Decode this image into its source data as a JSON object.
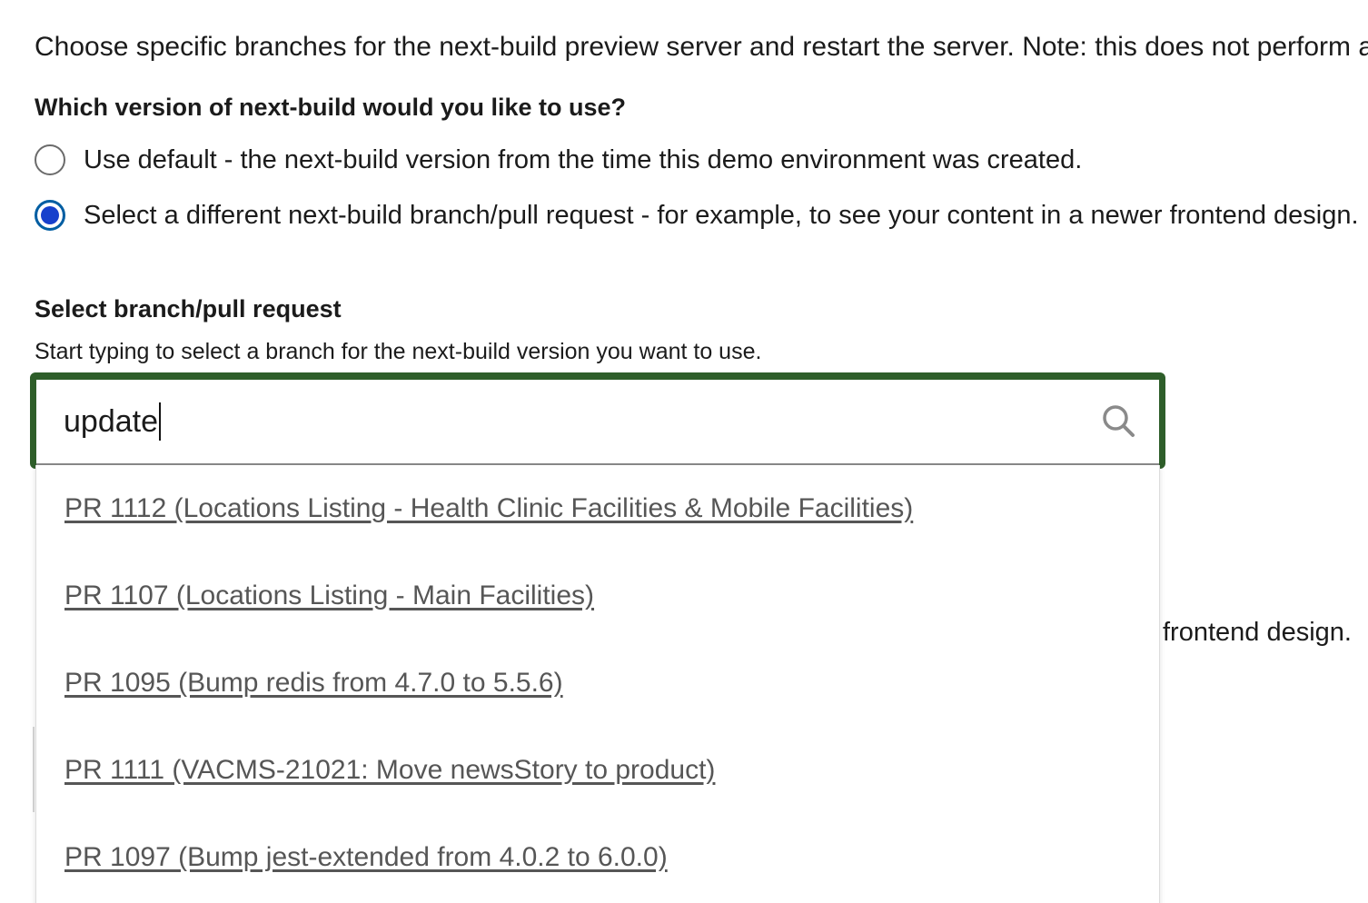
{
  "intro_text": "Choose specific branches for the next-build preview server and restart the server. Note: this does not perform a",
  "version_question": "Which version of next-build would you like to use?",
  "radio_options": [
    {
      "label": "Use default - the next-build version from the time this demo environment was created.",
      "checked": false
    },
    {
      "label": "Select a different next-build branch/pull request - for example, to see your content in a newer frontend design.",
      "checked": true
    }
  ],
  "branch_select": {
    "label": "Select branch/pull request",
    "hint": "Start typing to select a branch for the next-build version you want to use.",
    "input_value": "update",
    "search_icon": "search-icon"
  },
  "dropdown_options": [
    "PR 1112 (Locations Listing - Health Clinic Facilities & Mobile Facilities)",
    "PR 1107 (Locations Listing - Main Facilities)",
    "PR 1095 (Bump redis from 4.7.0 to 5.5.6)",
    "PR 1111 (VACMS-21021: Move newsStory to product)",
    "PR 1097 (Bump jest-extended from 4.0.2 to 6.0.0)"
  ],
  "obscured_text_fragment": "frontend design.",
  "colors": {
    "focus_border": "#2e5e2a",
    "radio_checked": "#1740cc",
    "option_link": "#565656",
    "text": "#1b1b1b"
  }
}
